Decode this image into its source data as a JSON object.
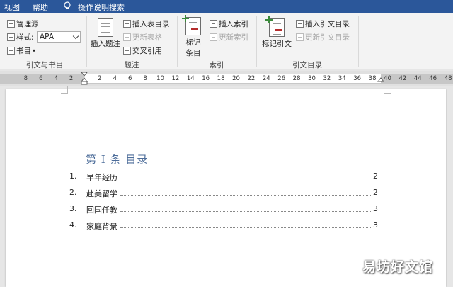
{
  "menubar": {
    "items": [
      "视图",
      "帮助",
      "操作说明搜索"
    ]
  },
  "ribbon": {
    "citations": {
      "manage_sources": "管理源",
      "style_label": "样式:",
      "style_value": "APA",
      "bibliography": "书目",
      "group_label": "引文与书目"
    },
    "captions": {
      "insert_caption": "插入题注",
      "insert_table_of_figures": "插入表目录",
      "update_table": "更新表格",
      "cross_reference": "交叉引用",
      "group_label": "题注"
    },
    "index": {
      "mark_entry_line1": "标记",
      "mark_entry_line2": "条目",
      "insert_index": "插入索引",
      "update_index": "更新索引",
      "group_label": "索引"
    },
    "toa": {
      "mark_citation": "标记引文",
      "insert_toa": "插入引文目录",
      "update_toa": "更新引文目录",
      "group_label": "引文目录"
    }
  },
  "ruler": {
    "left_numbers": [
      "8",
      "6",
      "4",
      "2"
    ],
    "right_numbers": [
      "2",
      "4",
      "6",
      "8",
      "10",
      "12",
      "14",
      "16",
      "18",
      "20",
      "22",
      "24",
      "26",
      "28",
      "30",
      "32",
      "34",
      "36",
      "38",
      "40",
      "42",
      "44",
      "46",
      "48"
    ]
  },
  "document": {
    "heading": "第 I 条    目录",
    "toc": [
      {
        "num": "1.",
        "title": "早年经历",
        "page": "2"
      },
      {
        "num": "2.",
        "title": "赴美留学",
        "page": "2"
      },
      {
        "num": "3.",
        "title": "回国任教",
        "page": "3"
      },
      {
        "num": "4.",
        "title": "家庭背景",
        "page": "3"
      }
    ]
  },
  "watermark": "易坊好文馆"
}
